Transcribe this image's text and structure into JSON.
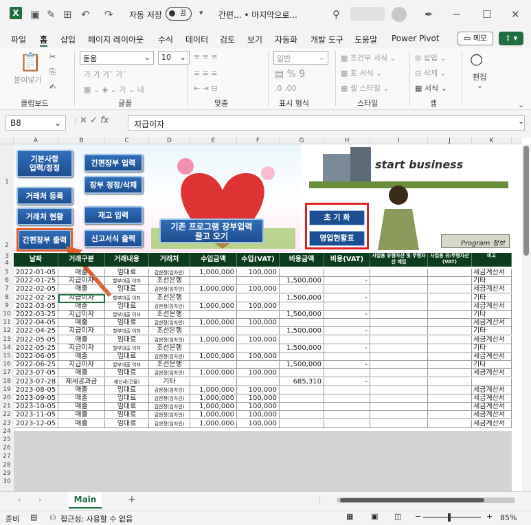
{
  "titlebar": {
    "autosave": "자동 저장",
    "autosave_state": "끔",
    "doc_title": "간편... • 마지막으로..."
  },
  "menu": [
    "파일",
    "홈",
    "삽입",
    "페이지 레이아웃",
    "수식",
    "데이터",
    "검토",
    "보기",
    "자동화",
    "개발 도구",
    "도움말",
    "Power Pivot"
  ],
  "memo": "메모",
  "ribbon": {
    "paste": "붙여넣기",
    "clipboard": "클립보드",
    "font_name": "돋움",
    "font_size": "10",
    "font": "글꼴",
    "align": "맞춤",
    "number_format": "일반",
    "number": "표시 형식",
    "cond_format": "조건부 서식",
    "table_format": "표 서식",
    "cell_style": "셀 스타일",
    "style": "스타일",
    "insert": "삽입",
    "delete": "삭제",
    "format": "서식",
    "cells": "셀",
    "edit": "편집"
  },
  "namebox": "B8",
  "formula": "지급이자",
  "columns": [
    "A",
    "B",
    "C",
    "D",
    "E",
    "F",
    "G",
    "H",
    "I",
    "J",
    "K"
  ],
  "row_numbers": [
    "1",
    "2",
    "3",
    "4",
    "5",
    "6",
    "7",
    "8",
    "9",
    "10",
    "11",
    "12",
    "13",
    "14",
    "15",
    "16",
    "17",
    "18",
    "19",
    "20",
    "21",
    "22",
    "23",
    "24",
    "25",
    "26",
    "27",
    "28",
    "29",
    "30"
  ],
  "buttons": {
    "basic": "기본사항\n입력/정정",
    "ledger_input": "간편장부 입력",
    "ledger_edit": "장부 정정/삭제",
    "vendor_reg": "거래처 등록",
    "vendor_status": "거래처 현황",
    "inventory": "재고 입력",
    "ledger_print": "간편장부 출력",
    "report_print": "신고서식 출력",
    "big": "기존 프로그램 장부입력\n끌고 오기",
    "init": "초 기 화",
    "sales": "영업현황표",
    "program_info": "Program 정보"
  },
  "banner_text": "start business",
  "headers": [
    "날짜",
    "거래구분",
    "거래내용",
    "거래처",
    "수입금액",
    "수입(VAT)",
    "비용금액",
    "비용(VAT)",
    "사업용 유형자산 및 무형자산 매입",
    "사업용 유/무형자산(VAT)",
    "비고"
  ],
  "rows": [
    [
      "2022-01-05",
      "매출",
      "임대료",
      "김현정(임차인)",
      "1,000,000",
      "100,000",
      "",
      "",
      "",
      "",
      "세금계산서"
    ],
    [
      "2022-01-25",
      "지급이자",
      "할부대출 이자",
      "조선은행",
      "",
      "",
      "1,500,000",
      "-",
      "",
      "",
      "기타"
    ],
    [
      "2022-02-05",
      "매출",
      "임대료",
      "김현정(임차인)",
      "1,000,000",
      "100,000",
      "",
      "",
      "",
      "",
      "세금계산서"
    ],
    [
      "2022-02-25",
      "지급이자",
      "할부대출 이자",
      "조선은행",
      "",
      "",
      "1,500,000",
      "-",
      "",
      "",
      "기타"
    ],
    [
      "2022-03-05",
      "매출",
      "임대료",
      "김현정(임차인)",
      "1,000,000",
      "100,000",
      "",
      "",
      "",
      "",
      "세금계산서"
    ],
    [
      "2022-03-25",
      "지급이자",
      "할부대출 이자",
      "조선은행",
      "",
      "",
      "1,500,000",
      "-",
      "",
      "",
      "기타"
    ],
    [
      "2022-04-05",
      "매출",
      "임대료",
      "김현정(임차인)",
      "1,000,000",
      "100,000",
      "",
      "",
      "",
      "",
      "세금계산서"
    ],
    [
      "2022-04-25",
      "지급이자",
      "할부대출 이자",
      "조선은행",
      "",
      "",
      "1,500,000",
      "-",
      "",
      "",
      "기타"
    ],
    [
      "2022-05-05",
      "매출",
      "임대료",
      "김현정(임차인)",
      "1,000,000",
      "100,000",
      "",
      "",
      "",
      "",
      "세금계산서"
    ],
    [
      "2022-05-25",
      "지급이자",
      "할부대출 이자",
      "조선은행",
      "",
      "",
      "1,500,000",
      "-",
      "",
      "",
      "기타"
    ],
    [
      "2022-06-05",
      "매출",
      "임대료",
      "김현정(임차인)",
      "1,000,000",
      "100,000",
      "",
      "",
      "",
      "",
      "세금계산서"
    ],
    [
      "2022-06-25",
      "지급이자",
      "할부대출 이자",
      "조선은행",
      "",
      "",
      "1,500,000",
      "-",
      "",
      "",
      "기타"
    ],
    [
      "2023-07-05",
      "매출",
      "임대료",
      "김현정(임차인)",
      "1,000,000",
      "100,000",
      "",
      "",
      "",
      "",
      "세금계산서"
    ],
    [
      "2023-07-28",
      "제세공과금",
      "재산세(건물)",
      "기타",
      "",
      "",
      "685,310",
      "-",
      "",
      "",
      ""
    ],
    [
      "2023-08-05",
      "매출",
      "임대료",
      "김현정(임차인)",
      "1,000,000",
      "100,000",
      "",
      "",
      "",
      "",
      "세금계산서"
    ],
    [
      "2023-09-05",
      "매출",
      "임대료",
      "김현정(임차인)",
      "1,000,000",
      "100,000",
      "",
      "",
      "",
      "",
      "세금계산서"
    ],
    [
      "2023-10-05",
      "매출",
      "임대료",
      "김현정(임차인)",
      "1,000,000",
      "100,000",
      "",
      "",
      "",
      "",
      "세금계산서"
    ],
    [
      "2023-11-05",
      "매출",
      "임대료",
      "김현정(임차인)",
      "1,000,000",
      "100,000",
      "",
      "",
      "",
      "",
      "세금계산서"
    ],
    [
      "2023-12-05",
      "매출",
      "임대료",
      "김현정(임차인)",
      "1,000,000",
      "100,000",
      "",
      "",
      "",
      "",
      "세금계산서"
    ]
  ],
  "sheet_tab": "Main",
  "status": {
    "ready": "준비",
    "accessibility": "접근성: 사용할 수 없음",
    "zoom": "85%"
  },
  "colors": {
    "excel_green": "#1d6f42",
    "header_bg": "#0b3d1c",
    "button_blue": "#1c4f91",
    "red_frame": "#e02020"
  }
}
